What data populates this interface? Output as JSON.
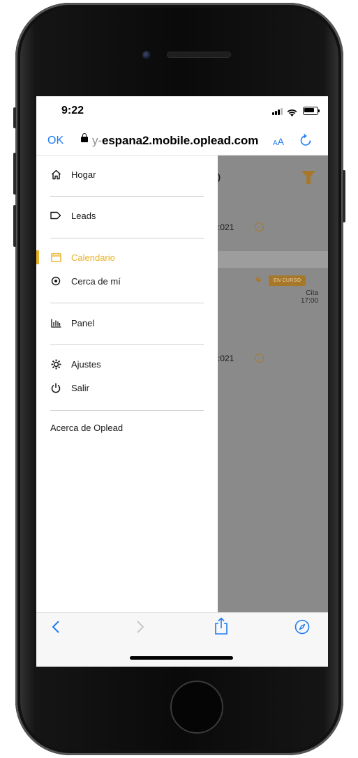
{
  "status_bar": {
    "time": "9:22"
  },
  "browser": {
    "done_label": "OK",
    "url_dim": "y-",
    "url_main": "espana2.mobile.oplead.com",
    "text_size_label": "AA",
    "reload_icon": "reload-icon"
  },
  "menu": {
    "items": [
      {
        "label": "Hogar",
        "icon": "home-icon"
      },
      {
        "label": "Leads",
        "icon": "tag-icon"
      },
      {
        "label": "Calendario",
        "icon": "calendar-icon",
        "active": true
      },
      {
        "label": "Cerca de mí",
        "icon": "location-icon"
      },
      {
        "label": "Panel",
        "icon": "bar-chart-icon"
      },
      {
        "label": "Ajustes",
        "icon": "gear-icon"
      },
      {
        "label": "Salir",
        "icon": "power-icon"
      }
    ],
    "about_label": "Acerca de Oplead",
    "accent_color": "#e8b12a"
  },
  "background_page": {
    "row1_fragment": ":021",
    "row2_fragment": ":021",
    "header_fragment": ")",
    "status_badge": "EN CURSO",
    "event_type": "Cita",
    "event_time": "17:00"
  },
  "toolbar": {
    "back_icon": "back-icon",
    "forward_icon": "forward-icon",
    "share_icon": "share-icon",
    "compass_icon": "compass-icon"
  }
}
